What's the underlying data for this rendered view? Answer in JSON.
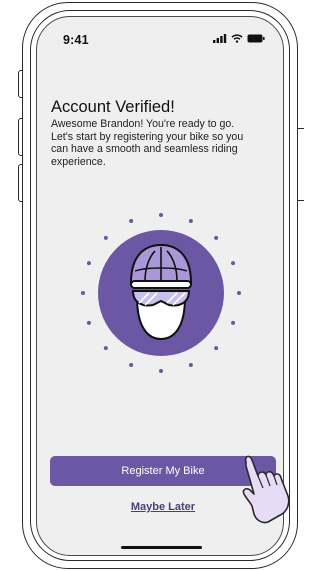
{
  "status_bar": {
    "time": "9:41",
    "icons": [
      "signal-icon",
      "wifi-icon",
      "battery-icon"
    ]
  },
  "content": {
    "heading": "Account Verified!",
    "description_lines": [
      "Awesome Brandon! You're ready to go.",
      "Let's start by registering your bike so you",
      "can have a smooth and seamless riding",
      "experience."
    ]
  },
  "illustration": {
    "icon": "cyclist-helmet-icon"
  },
  "actions": {
    "primary_label": "Register My Bike",
    "secondary_label": "Maybe Later"
  },
  "colors": {
    "accent": "#6b57a3",
    "accent_light": "#a898d8",
    "screen_bg": "#efeff0",
    "link": "#4a3f7a"
  }
}
